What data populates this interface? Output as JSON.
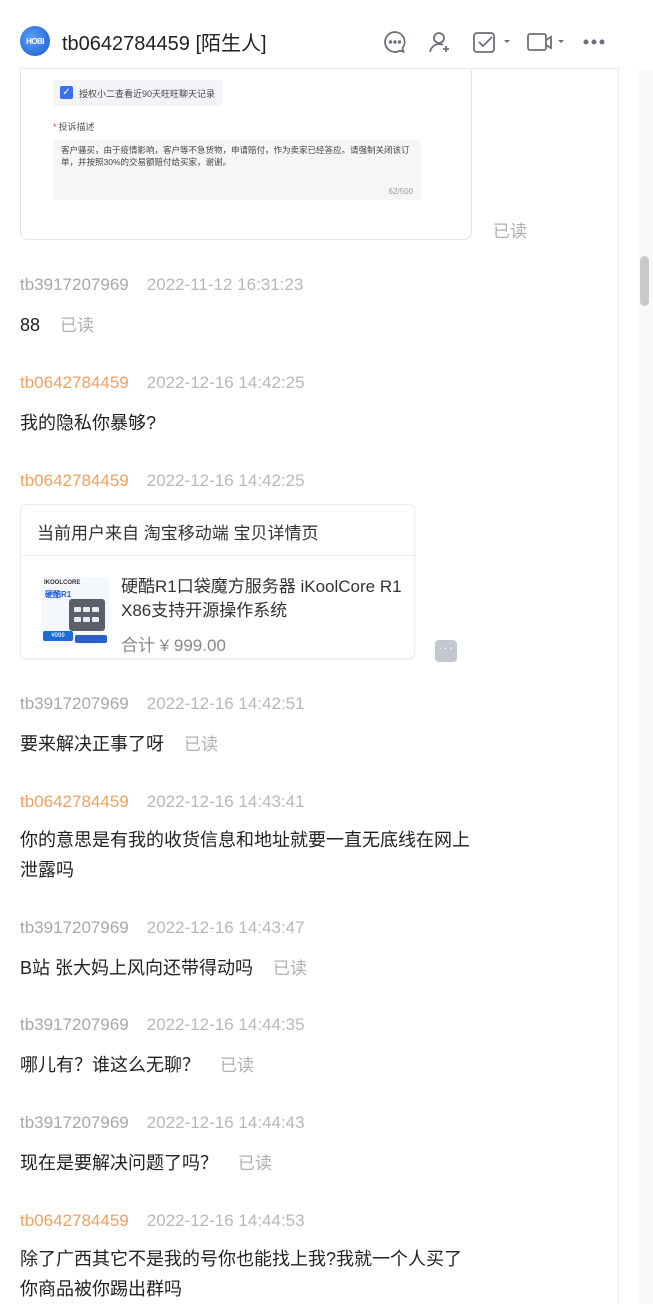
{
  "header": {
    "avatar_text": "HOBI",
    "title": "tb0642784459 [陌生人]",
    "icons": [
      "chat-bubble-icon",
      "add-contact-icon",
      "task-check-icon",
      "video-call-icon",
      "more-icon"
    ]
  },
  "complaint": {
    "auth_label": "授权小二查看近90天旺旺聊天记录",
    "field_label": "投诉描述",
    "required_mark": "*",
    "description": "客户骚买，由于疫情影响，客户等不急货物，申请赔付，作为卖家已经答应。请强制关闭该订单，并按照30%的交易额赔付给买家，谢谢。",
    "char_count": "62/500",
    "read": "已读"
  },
  "messages": [
    {
      "sender": "tb3917207969",
      "time": "2022-11-12 16:31:23",
      "text": "88",
      "read": "已读"
    },
    {
      "sender": "tb0642784459",
      "time": "2022-12-16 14:42:25",
      "text": "我的隐私你暴够?"
    },
    {
      "sender": "tb0642784459",
      "time": "2022-12-16 14:42:25"
    },
    {
      "sender": "tb3917207969",
      "time": "2022-12-16 14:42:51",
      "text": "要来解决正事了呀",
      "read": "已读"
    },
    {
      "sender": "tb0642784459",
      "time": "2022-12-16 14:43:41",
      "text_line1": "你的意思是有我的收货信息和地址就要一直无底线在网上",
      "text_line2": "泄露吗"
    },
    {
      "sender": "tb3917207969",
      "time": "2022-12-16 14:43:47",
      "text": "B站 张大妈上风向还带得动吗",
      "read": "已读"
    },
    {
      "sender": "tb3917207969",
      "time": "2022-12-16 14:44:35",
      "text": "哪儿有？谁这么无聊？",
      "read": "已读"
    },
    {
      "sender": "tb3917207969",
      "time": "2022-12-16 14:44:43",
      "text": "现在是要解决问题了吗？",
      "read": "已读"
    },
    {
      "sender": "tb0642784459",
      "time": "2022-12-16 14:44:53",
      "text_line1": "除了广西其它不是我的号你也能找上我?我就一个人买了",
      "text_line2": "你商品被你踢出群吗"
    }
  ],
  "product_card": {
    "source": "当前用户来自 淘宝移动端 宝贝详情页",
    "thumb_brand": "IKOOLCORE",
    "thumb_name": "硬酷R1",
    "thumb_price": "¥999",
    "title": "硬酷R1口袋魔方服务器 iKoolCore R1 X86支持开源操作系统",
    "price": "合计 ¥ 999.00"
  },
  "colors": {
    "self_sender": "#f0a060",
    "other_sender": "#a8a8a8",
    "accent": "#3a6ff0"
  }
}
